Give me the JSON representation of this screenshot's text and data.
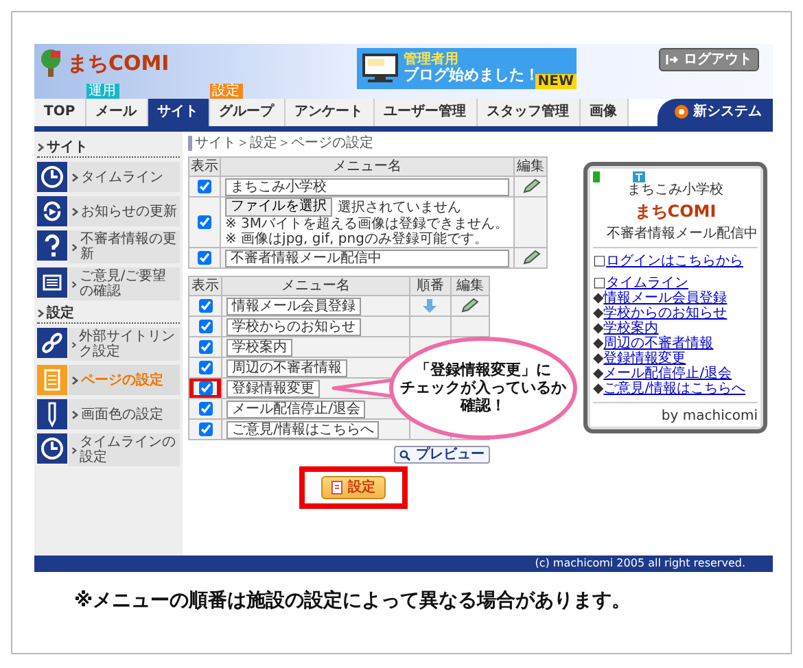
{
  "header": {
    "logo": "まちCOMI",
    "banner": {
      "badge": "NEW",
      "subtitle": "管理者用",
      "title": "ブログ始めました！"
    },
    "logout": "ログアウト"
  },
  "nav": {
    "tabs": [
      {
        "label": "TOP",
        "selected": false
      },
      {
        "label": "メール",
        "selected": false,
        "tag": "運用",
        "color": "#19b5c9"
      },
      {
        "label": "サイト",
        "selected": true
      },
      {
        "label": "グループ",
        "selected": false,
        "tag": "設定",
        "color": "#f08a1c"
      },
      {
        "label": "アンケート",
        "selected": false
      },
      {
        "label": "ユーザー管理",
        "selected": false
      },
      {
        "label": "スタッフ管理",
        "selected": false
      },
      {
        "label": "画像",
        "selected": false
      }
    ],
    "system_link": "新システム"
  },
  "sidebar": {
    "sections": [
      {
        "title": "サイト",
        "items": [
          {
            "label": "タイムライン",
            "kind": "clock",
            "selected": false
          },
          {
            "label": "お知らせの更新",
            "kind": "refresh",
            "selected": false
          },
          {
            "label": "不審者情報の更新",
            "kind": "question",
            "selected": false
          },
          {
            "label": "ご意見/ご要望の確認",
            "kind": "list",
            "selected": false
          }
        ]
      },
      {
        "title": "設定",
        "items": [
          {
            "label": "外部サイトリンク設定",
            "kind": "link",
            "selected": false
          },
          {
            "label": "ページの設定",
            "kind": "page",
            "selected": true
          },
          {
            "label": "画面色の設定",
            "kind": "pencil",
            "selected": false
          },
          {
            "label": "タイムラインの設定",
            "kind": "clock",
            "selected": false
          }
        ]
      }
    ]
  },
  "breadcrumb": "サイト＞設定＞ページの設定",
  "header_table": {
    "columns": [
      "表示",
      "メニュー名",
      "編集"
    ],
    "rows": [
      {
        "kind": "text",
        "checked": true,
        "value": "まちこみ小学校"
      },
      {
        "kind": "file",
        "checked": true,
        "button": "ファイルを選択",
        "status": "選択されていません",
        "notes": [
          "※ 3Mバイトを超える画像は登録できません。",
          "※ 画像はjpg, gif, pngのみ登録可能です。"
        ]
      },
      {
        "kind": "text",
        "checked": true,
        "value": "不審者情報メール配信中"
      }
    ]
  },
  "menu_table": {
    "columns": [
      "表示",
      "メニュー名",
      "順番",
      "編集"
    ],
    "rows": [
      {
        "kind": "reorder",
        "checked": true,
        "value": "情報メール会員登録",
        "highlighted": false
      },
      {
        "kind": "plain",
        "checked": true,
        "value": "学校からのお知らせ",
        "highlighted": false
      },
      {
        "kind": "plain",
        "checked": true,
        "value": "学校案内",
        "highlighted": false
      },
      {
        "kind": "plain",
        "checked": true,
        "value": "周辺の不審者情報",
        "highlighted": false
      },
      {
        "kind": "plain",
        "checked": true,
        "value": "登録情報変更",
        "highlighted": true
      },
      {
        "kind": "plain",
        "checked": true,
        "value": "メール配信停止/退会",
        "highlighted": false
      },
      {
        "kind": "plain",
        "checked": true,
        "value": "ご意見/情報はこちらへ",
        "highlighted": false
      }
    ]
  },
  "preview_button": "プレビュー",
  "submit": {
    "label": "設定",
    "highlighted": true
  },
  "phone": {
    "school": "まちこみ小学校",
    "logo": "まちCOMI",
    "status": "不審者情報メール配信中",
    "login": {
      "bullet": "□",
      "label": "ログインはこちらから"
    },
    "links": [
      {
        "bullet": "□",
        "label": "タイムライン"
      },
      {
        "bullet": "◆",
        "label": "情報メール会員登録"
      },
      {
        "bullet": "◆",
        "label": "学校からのお知らせ"
      },
      {
        "bullet": "◆",
        "label": "学校案内"
      },
      {
        "bullet": "◆",
        "label": "周辺の不審者情報"
      },
      {
        "bullet": "◆",
        "label": "登録情報変更"
      },
      {
        "bullet": "◆",
        "label": "メール配信停止/退会"
      },
      {
        "bullet": "◆",
        "label": "ご意見/情報はこちらへ"
      }
    ],
    "footer": "by machicomi"
  },
  "callout": {
    "lines": [
      "「登録情報変更」に",
      "チェックが入っているか",
      "確認！"
    ]
  },
  "footer": "(c) machicomi 2005 all right reserved.",
  "note": "※メニューの順番は施設の設定によって異なる場合があります。"
}
